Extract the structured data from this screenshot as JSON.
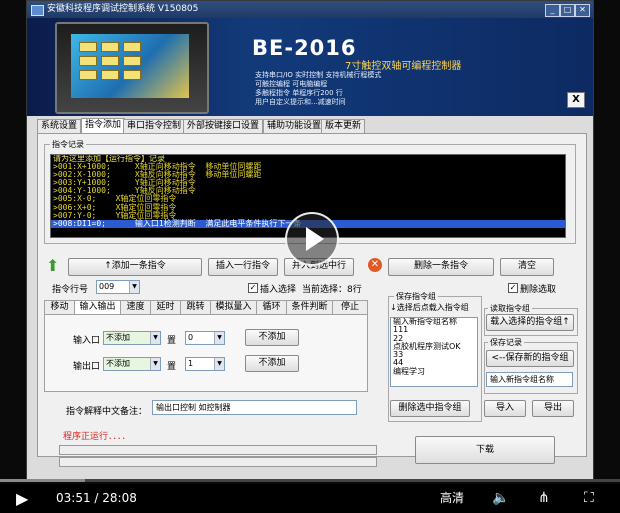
{
  "window": {
    "title": "安徽科技程序调试控制系统 V150805",
    "buttons": [
      "_",
      "□",
      "✕"
    ]
  },
  "banner": {
    "brand": "BE-2016",
    "subtitle": "7寸触控双轴可编程控制器",
    "features": [
      "支持串口/IO 实时控制   支持机械行程模式",
      "可触控编程  可电脑编程",
      "多触程指令  单程序行200 行",
      "用户自定义提示和...减速时间"
    ],
    "close": "X"
  },
  "tabs": [
    "系统设置",
    "指令添加",
    "串口指令控制",
    "外部按键接口设置",
    "辅助功能设置",
    "版本更新"
  ],
  "cmd_log": {
    "group_label": "指令记录",
    "lines": [
      "请为这里添加【运行指令】记录",
      ">001:X+1000;     X轴正向移动指令  移动单位同螺距",
      ">002:X-1000;     X轴反向移动指令  移动单位同螺距",
      ">003:Y+1000;     Y轴正向移动指令",
      ">004:Y-1000;     Y轴反向移动指令",
      ">005:X-0;    X轴定位回零指令",
      ">006:X+0;    X轴定位回零指令",
      ">007:Y-0;    Y轴定位回零指令",
      ">008:DI1=0;      输入口1检测判断  满足此电平条件执行下一条"
    ],
    "selected_index": 8
  },
  "actions": {
    "add": "↑添加一条指令",
    "insert": "插入一行指令",
    "replace": "并入到选中行",
    "delete": "删除一条指令",
    "clear": "清空"
  },
  "line_no": {
    "label": "指令行号",
    "value": "009"
  },
  "insert_check": {
    "label": "插入选择",
    "checked": true
  },
  "current_sel": "当前选择：8行",
  "delete_check": {
    "label": "删除选取",
    "checked": true
  },
  "subtabs": [
    "移动",
    "输入输出",
    "速度",
    "延时",
    "跳转",
    "模拟量入",
    "循环",
    "条件判断",
    "停止"
  ],
  "io": {
    "input": {
      "label": "输入口",
      "value": "不添加",
      "set_label": "置",
      "level": "0",
      "button": "不添加"
    },
    "output": {
      "label": "输出口",
      "value": "不添加",
      "set_label": "置",
      "level": "1",
      "button": "不添加"
    }
  },
  "note": {
    "label": "指令解释中文备注：",
    "value": "输出口控制  如控制器"
  },
  "program_group": {
    "label": "保存指令组",
    "sublabel": "↓选择后点载入指令组",
    "items": [
      "输入新指令组名称",
      "111",
      "22",
      "点胶机程序测试OK",
      "33",
      "44",
      "编程学习"
    ],
    "delete_btn": "删除选中指令组",
    "import": "导入",
    "export": "导出"
  },
  "read_group": {
    "label": "读取指令组",
    "button": "载入选择的指令组↑"
  },
  "save_group": {
    "label": "保存记录",
    "button": "<--保存新的指令组",
    "input": "输入新指令组名称"
  },
  "status": {
    "text": "程序正运行．．．．",
    "download": "下载"
  },
  "player": {
    "time": "03:51 / 28:08",
    "quality": "高清",
    "progress": 0.137
  }
}
